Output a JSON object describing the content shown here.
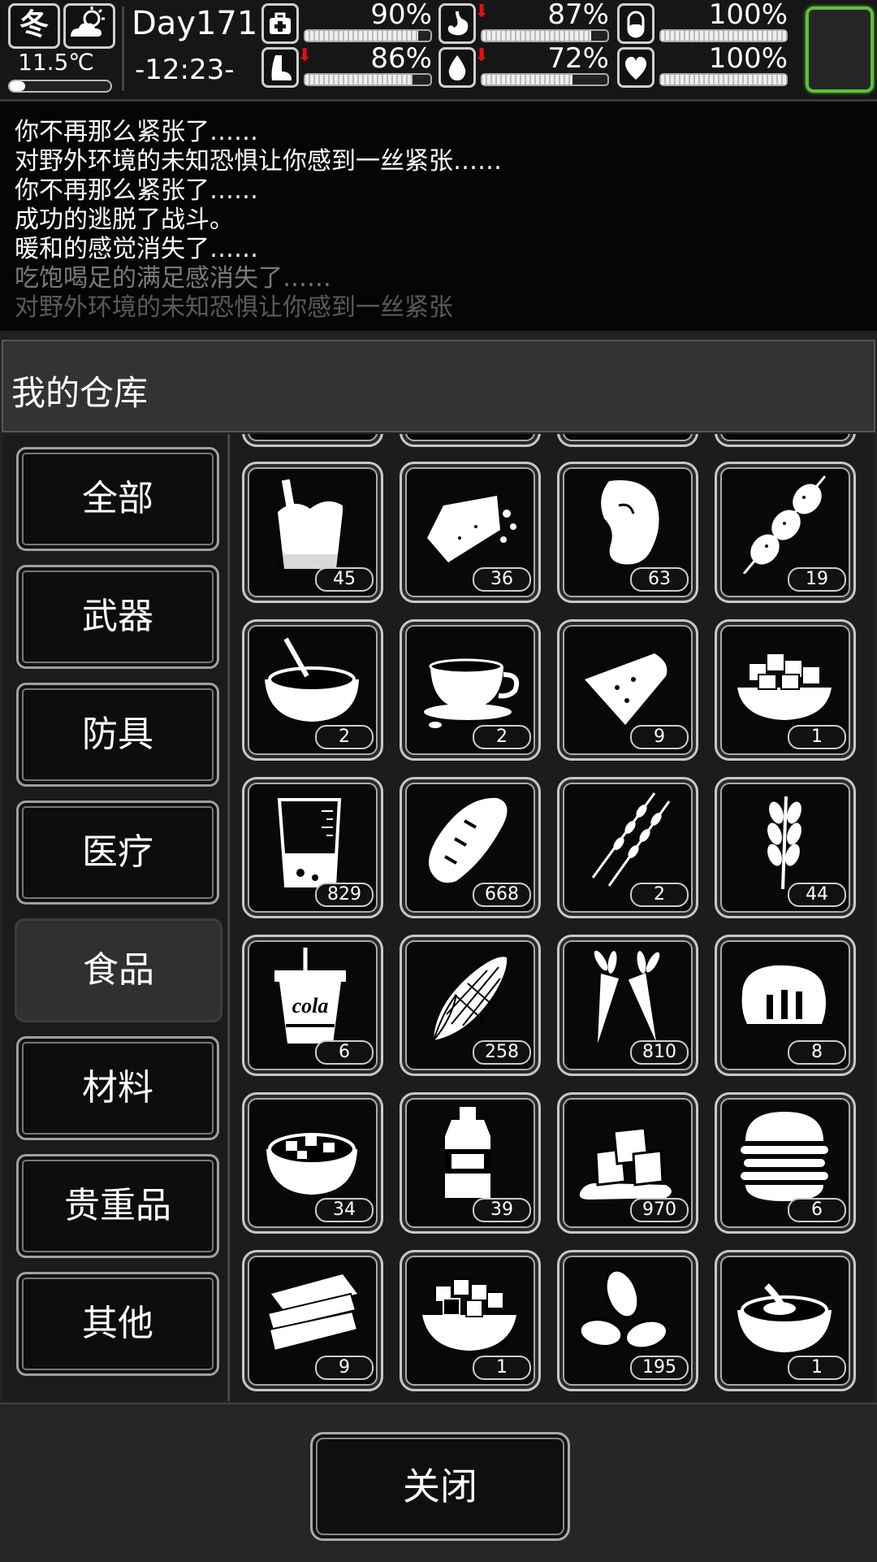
{
  "hud": {
    "season": "冬",
    "weather_icon": "partly-cloudy-icon",
    "temperature": "11.5℃",
    "temperature_level": 0.15,
    "day": "Day171",
    "time": "-12:23-",
    "stats": [
      {
        "name": "health",
        "icon": "medkit-icon",
        "value": "90%",
        "level": 0.9,
        "falling": false
      },
      {
        "name": "stomach",
        "icon": "stomach-icon",
        "value": "87%",
        "level": 0.87,
        "falling": true
      },
      {
        "name": "pill",
        "icon": "pill-icon",
        "value": "100%",
        "level": 1.0,
        "falling": false
      },
      {
        "name": "stamina",
        "icon": "foot-icon",
        "value": "86%",
        "level": 0.86,
        "falling": true
      },
      {
        "name": "water",
        "icon": "water-drop-icon",
        "value": "72%",
        "level": 0.72,
        "falling": true
      },
      {
        "name": "mood",
        "icon": "heart-icon",
        "value": "100%",
        "level": 1.0,
        "falling": false
      }
    ],
    "falling_mark": "⬇"
  },
  "log": [
    {
      "text": "你不再那么紧张了……",
      "color": "#ffffff"
    },
    {
      "text": "对野外环境的未知恐惧让你感到一丝紧张……",
      "color": "#ffffff"
    },
    {
      "text": "你不再那么紧张了……",
      "color": "#ffffff"
    },
    {
      "text": "成功的逃脱了战斗。",
      "color": "#ffffff"
    },
    {
      "text": "暖和的感觉消失了……",
      "color": "#ffffff"
    },
    {
      "text": "吃饱喝足的满足感消失了……",
      "color": "#7a7a7a"
    },
    {
      "text": "对野外环境的未知恐惧让你感到一丝紧张",
      "color": "#5a5a5a"
    }
  ],
  "panel": {
    "title": "我的仓库",
    "categories": [
      "全部",
      "武器",
      "防具",
      "医疗",
      "食品",
      "材料",
      "贵重品",
      "其他"
    ],
    "selected_category": "食品",
    "close_label": "关闭"
  },
  "items": [
    {
      "icon": "ice-cream-bucket-icon",
      "count": "45"
    },
    {
      "icon": "tofu-icon",
      "count": "36"
    },
    {
      "icon": "steak-icon",
      "count": "63"
    },
    {
      "icon": "meat-skewer-icon",
      "count": "19"
    },
    {
      "icon": "soup-bowl-icon",
      "count": "2"
    },
    {
      "icon": "coffee-cup-icon",
      "count": "2"
    },
    {
      "icon": "pizza-slice-icon",
      "count": "9"
    },
    {
      "icon": "diced-bowl-icon",
      "count": "1"
    },
    {
      "icon": "beaker-icon",
      "count": "829"
    },
    {
      "icon": "bread-loaf-icon",
      "count": "668"
    },
    {
      "icon": "kebab-sticks-icon",
      "count": "2"
    },
    {
      "icon": "wheat-icon",
      "count": "44"
    },
    {
      "icon": "cola-cup-icon",
      "count": "6",
      "label": "cola"
    },
    {
      "icon": "corn-icon",
      "count": "258"
    },
    {
      "icon": "carrot-icon",
      "count": "810"
    },
    {
      "icon": "bun-icon",
      "count": "8"
    },
    {
      "icon": "stew-pot-icon",
      "count": "34"
    },
    {
      "icon": "bottle-icon",
      "count": "39"
    },
    {
      "icon": "ice-cubes-icon",
      "count": "970"
    },
    {
      "icon": "burger-icon",
      "count": "6"
    },
    {
      "icon": "sandwich-icon",
      "count": "9"
    },
    {
      "icon": "diced-salad-icon",
      "count": "1"
    },
    {
      "icon": "nuts-icon",
      "count": "195"
    },
    {
      "icon": "broth-bowl-icon",
      "count": "1"
    }
  ]
}
